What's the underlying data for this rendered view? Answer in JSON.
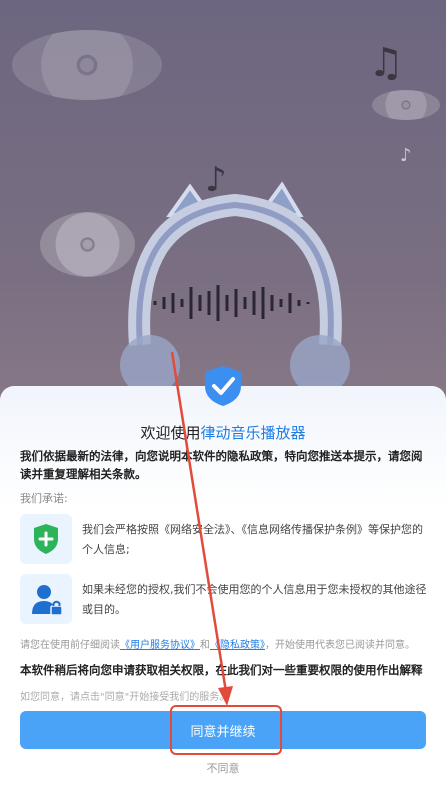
{
  "dialog": {
    "title_prefix": "欢迎使用",
    "app_name": "律动音乐播放器",
    "intro": "我们依据最新的法律，向您说明本软件的隐私政策，特向您推送本提示，请您阅读并重复理解相关条款。",
    "promise_label": "我们承诺:",
    "items": [
      {
        "text": "我们会严格按照《网络安全法》、《信息网络传播保护条例》等保护您的个人信息;",
        "icon": "shield-plus-icon"
      },
      {
        "text": "如果未经您的授权,我们不会使用您的个人信息用于您未授权的其他途径或目的。",
        "icon": "user-lock-icon"
      }
    ],
    "notice_pre": "请您在使用前仔细阅读",
    "user_agreement": "《用户服务协议》",
    "and": "和",
    "privacy_policy": "《隐私政策》",
    "notice_post": "，开始使用代表您已阅读并同意。",
    "permission_text": "本软件稍后将向您申请获取相关权限，在此我们对一些重要权限的使用作出解释",
    "hint": "如您同意，请点击\"同意\"开始接受我们的服务。",
    "agree_label": "同意并继续",
    "disagree_label": "不同意"
  },
  "colors": {
    "accent": "#4aa3f7",
    "link": "#1f7de6",
    "annotation": "#e24a3b"
  }
}
